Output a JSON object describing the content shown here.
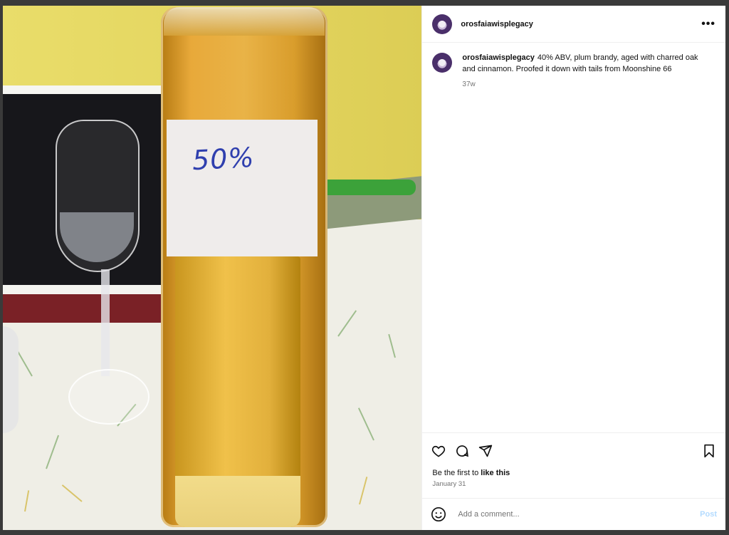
{
  "post": {
    "username": "orosfaiawisplegacy",
    "photo_label_text": "50%",
    "caption": {
      "username": "orosfaiawisplegacy",
      "text": "40% ABV, plum brandy, aged with charred oak and cinnamon. Proofed it down with tails from Moonshine 66",
      "time_ago": "37w"
    },
    "likes": {
      "prefix": "Be the first to",
      "action": "like this"
    },
    "date": "January 31",
    "comment_box": {
      "placeholder": "Add a comment...",
      "post_label": "Post"
    }
  },
  "icons": {
    "more": "more-options-icon",
    "like": "heart-icon",
    "comment": "comment-icon",
    "share": "share-icon",
    "save": "bookmark-icon",
    "emoji": "emoji-icon"
  },
  "colors": {
    "post_button": "#b3dbff",
    "muted_text": "#737373",
    "label_ink": "#2f3fae"
  }
}
